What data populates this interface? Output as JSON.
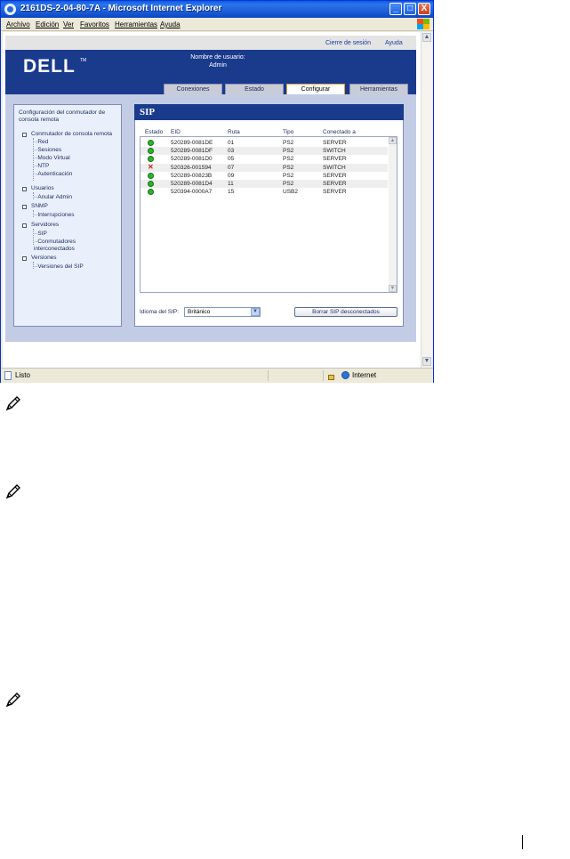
{
  "window": {
    "title": "2161DS-2-04-80-7A - Microsoft Internet Explorer",
    "min_label": "_",
    "max_label": "□",
    "close_label": "X"
  },
  "menubar": {
    "items": [
      "Archivo",
      "Edición",
      "Ver",
      "Favoritos",
      "Herramientas",
      "Ayuda"
    ]
  },
  "page": {
    "logout": "Cierre de sesión",
    "help": "Ayuda",
    "logo": "DELL",
    "logo_tm": "TM",
    "user_label": "Nombre de usuario:",
    "user_name": "Admin",
    "tabs": [
      "Conexiones",
      "Estado",
      "Configurar",
      "Herramientas"
    ],
    "active_tab": "Configurar"
  },
  "nav": {
    "title": "Configuración del conmutador de consola remota",
    "groups": [
      {
        "label": "Conmutador de consola remota",
        "children": [
          "Red",
          "Sesiones",
          "Modo Virtual",
          "NTP",
          "Autenticación"
        ]
      },
      {
        "label": "Usuarios",
        "children": [
          "Anular Admin"
        ]
      },
      {
        "label": "SNMP",
        "children": [
          "Interrupciones"
        ]
      },
      {
        "label": "Servidores",
        "children": [
          "SIP",
          "Conmutadores interconectados"
        ]
      },
      {
        "label": "Versiones",
        "children": [
          "Versiones del SIP"
        ]
      }
    ]
  },
  "sip": {
    "title": "SIP",
    "columns": [
      "Estado",
      "EID",
      "Ruta",
      "Tipo",
      "Conectado a"
    ],
    "rows": [
      {
        "status": "ok",
        "eid": "520289-0081DE",
        "ruta": "01",
        "tipo": "PS2",
        "conectado": "SERVER"
      },
      {
        "status": "ok",
        "eid": "520289-0081DF",
        "ruta": "03",
        "tipo": "PS2",
        "conectado": "SWITCH"
      },
      {
        "status": "ok",
        "eid": "520289-0081D0",
        "ruta": "05",
        "tipo": "PS2",
        "conectado": "SERVER"
      },
      {
        "status": "error",
        "eid": "520326-001594",
        "ruta": "07",
        "tipo": "PS2",
        "conectado": "SWITCH"
      },
      {
        "status": "ok",
        "eid": "520289-00823B",
        "ruta": "09",
        "tipo": "PS2",
        "conectado": "SERVER"
      },
      {
        "status": "ok",
        "eid": "520289-0081D4",
        "ruta": "11",
        "tipo": "PS2",
        "conectado": "SERVER"
      },
      {
        "status": "ok",
        "eid": "520394-0000A7",
        "ruta": "15",
        "tipo": "USB2",
        "conectado": "SERVER"
      }
    ],
    "lang_label": "Idioma del SIP:",
    "lang_value": "Británico",
    "delete_button": "Borrar SIP desconectados"
  },
  "statusbar": {
    "text": "Listo",
    "zone": "Internet"
  },
  "colors": {
    "dell_blue": "#1a3a8c",
    "title_bar": "#2a74ec",
    "status_ok": "#2bb52b",
    "status_error": "#d01c1c"
  }
}
